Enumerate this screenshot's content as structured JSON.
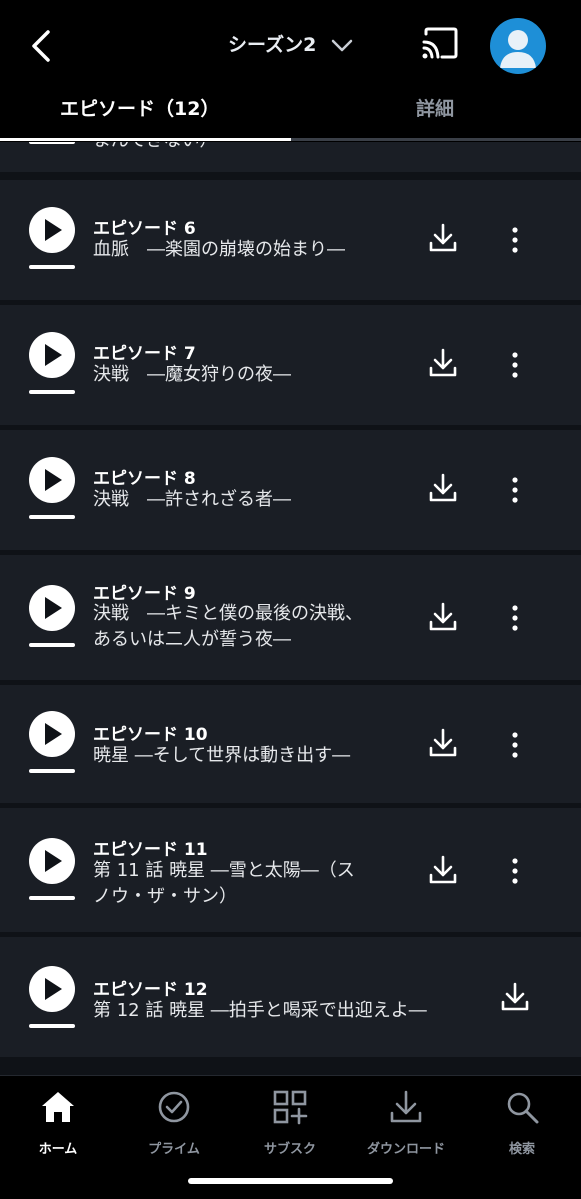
{
  "header": {
    "season_label": "シーズン2",
    "tabs": [
      {
        "label": "エピソード（12）",
        "active": true
      },
      {
        "label": "詳細",
        "active": false
      }
    ],
    "icons": {
      "back": "chevron-left-icon",
      "season_dropdown": "chevron-down-icon",
      "cast": "cast-icon",
      "avatar": "user-avatar-icon"
    }
  },
  "episode_list": {
    "partial_previous_subtitle": "まんてきない）",
    "episodes": [
      {
        "title": "エピソード 6",
        "subtitle": "血脈　―楽園の崩壊の始まり―",
        "has_more_menu": true
      },
      {
        "title": "エピソード 7",
        "subtitle": "決戦　―魔女狩りの夜―",
        "has_more_menu": true
      },
      {
        "title": "エピソード 8",
        "subtitle": "決戦　―許されざる者―",
        "has_more_menu": true
      },
      {
        "title": "エピソード 9",
        "subtitle": "決戦　―キミと僕の最後の決戦、あるいは二人が誓う夜―",
        "has_more_menu": true
      },
      {
        "title": "エピソード 10",
        "subtitle": "暁星 ―そして世界は動き出す―",
        "has_more_menu": true
      },
      {
        "title": "エピソード 11",
        "subtitle": "第 11 話 暁星 ―雪と太陽―（スノウ・ザ・サン）",
        "has_more_menu": true
      },
      {
        "title": "エピソード 12",
        "subtitle": "第 12 話 暁星 ―拍手と喝采で出迎えよ―",
        "has_more_menu": false
      }
    ]
  },
  "bottom_nav": {
    "items": [
      {
        "label": "ホーム",
        "icon": "home-icon",
        "active": true
      },
      {
        "label": "プライム",
        "icon": "check-circle-icon",
        "active": false
      },
      {
        "label": "サブスク",
        "icon": "grid-plus-icon",
        "active": false
      },
      {
        "label": "ダウンロード",
        "icon": "download-icon",
        "active": false
      },
      {
        "label": "検索",
        "icon": "search-icon",
        "active": false
      }
    ]
  },
  "colors": {
    "background": "#000000",
    "card": "#1a1e25",
    "text_primary": "#ffffff",
    "text_muted": "#8f96a0",
    "avatar": "#1e8fd7"
  }
}
